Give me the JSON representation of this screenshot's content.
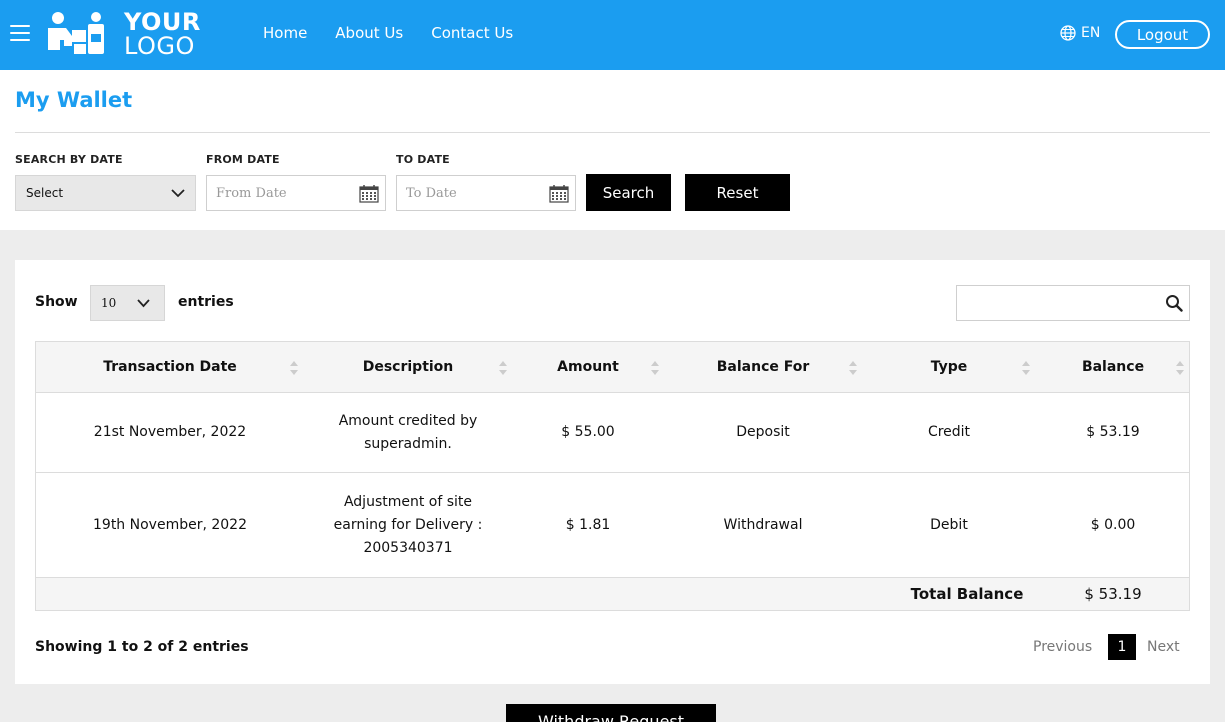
{
  "header": {
    "logo_line1": "YOUR",
    "logo_line2": "LOGO",
    "nav": [
      "Home",
      "About Us",
      "Contact Us"
    ],
    "language": "EN",
    "logout_label": "Logout",
    "color": "#1b9df0"
  },
  "page": {
    "title": "My Wallet"
  },
  "filters": {
    "search_by_date_label": "SEARCH BY DATE",
    "search_by_date_value": "Select",
    "from_date_label": "FROM DATE",
    "from_date_placeholder": "From Date",
    "to_date_label": "TO DATE",
    "to_date_placeholder": "To Date",
    "search_label": "Search",
    "reset_label": "Reset"
  },
  "table_controls": {
    "show_label": "Show",
    "entries_value": "10",
    "entries_label": "entries"
  },
  "table": {
    "columns": [
      "Transaction Date",
      "Description",
      "Amount",
      "Balance For",
      "Type",
      "Balance"
    ],
    "rows": [
      [
        "21st November, 2022",
        "Amount credited by superadmin.",
        "$ 55.00",
        "Deposit",
        "Credit",
        "$ 53.19"
      ],
      [
        "19th November, 2022",
        "Adjustment of site earning for Delivery : 2005340371",
        "$ 1.81",
        "Withdrawal",
        "Debit",
        "$ 0.00"
      ]
    ],
    "total_label": "Total Balance",
    "total_value": "$ 53.19"
  },
  "pagination": {
    "info": "Showing 1 to 2 of 2 entries",
    "previous": "Previous",
    "current": "1",
    "next": "Next"
  },
  "withdraw_label": "Withdraw Request"
}
